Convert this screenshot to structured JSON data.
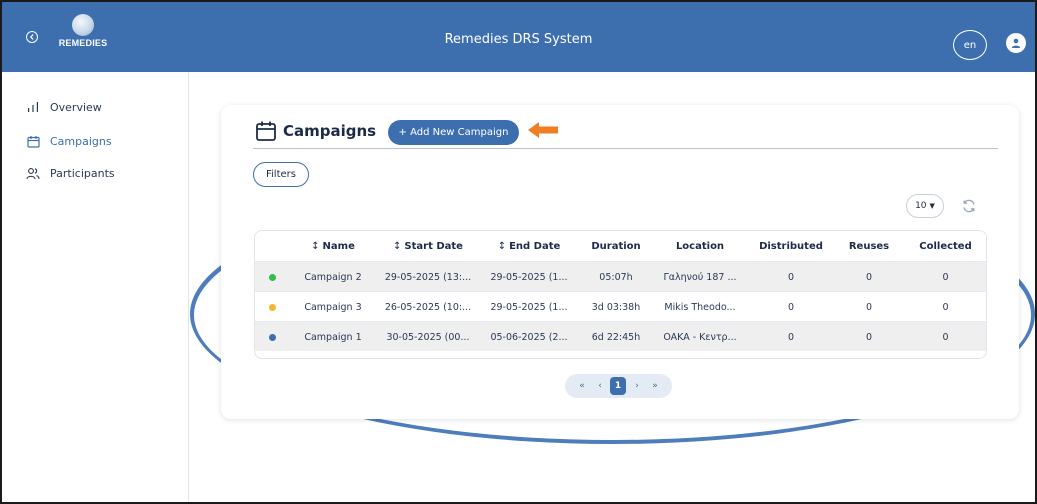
{
  "header": {
    "logo_text": "REMEDIES",
    "title": "Remedies DRS System",
    "lang": "en",
    "bg_color": "#3d6fae"
  },
  "sidebar": {
    "items": [
      {
        "label": "Overview",
        "icon": "bar-chart-icon"
      },
      {
        "label": "Campaigns",
        "icon": "calendar-icon",
        "active": true
      },
      {
        "label": "Participants",
        "icon": "users-icon"
      }
    ]
  },
  "main": {
    "title": "Campaigns",
    "add_button": "+ Add New Campaign",
    "filters_button": "Filters",
    "page_size": "10",
    "table": {
      "columns": [
        "Name",
        "Start Date",
        "End Date",
        "Duration",
        "Location",
        "Distributed",
        "Reuses",
        "Collected"
      ],
      "rows": [
        {
          "status": "#2fbf4a",
          "name": "Campaign 2",
          "start": "29-05-2025 (13:...",
          "end": "29-05-2025 (1...",
          "duration": "05:07h",
          "location": "Γαληνού 187 ...",
          "distributed": "0",
          "reuses": "0",
          "collected": "0"
        },
        {
          "status": "#f5b731",
          "name": "Campaign 3",
          "start": "26-05-2025 (10:...",
          "end": "29-05-2025 (1...",
          "duration": "3d 03:38h",
          "location": "Mikis Theodo...",
          "distributed": "0",
          "reuses": "0",
          "collected": "0"
        },
        {
          "status": "#3d6fae",
          "name": "Campaign 1",
          "start": "30-05-2025 (00...",
          "end": "05-06-2025 (2...",
          "duration": "6d 22:45h",
          "location": "OAKA - Κεντρ...",
          "distributed": "0",
          "reuses": "0",
          "collected": "0"
        }
      ]
    },
    "pagination": {
      "first": "«",
      "prev": "‹",
      "current": "1",
      "next": "›",
      "last": "»"
    }
  }
}
